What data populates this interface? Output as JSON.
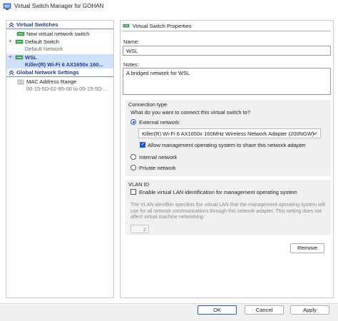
{
  "window": {
    "title": "Virtual Switch Manager for GOHAN"
  },
  "sidebar": {
    "virtual_switches_header": "Virtual Switches",
    "new_switch_label": "New virtual network switch",
    "switches": [
      {
        "name": "Default Switch",
        "detail": "Default Network"
      },
      {
        "name": "WSL",
        "detail": "Killer(R) Wi-Fi 6 AX1650x 160..."
      }
    ],
    "global_header": "Global Network Settings",
    "mac_label": "MAC Address Range",
    "mac_value": "00-15-5D-02-95-00 to 00-15-5D-..."
  },
  "properties": {
    "header": "Virtual Switch Properties",
    "name_label": "Name:",
    "name_value": "WSL",
    "notes_label": "Notes:",
    "notes_value": "A bridged network for WSL",
    "connection_type_label": "Connection type",
    "question": "What do you want to connect this virtual switch to?",
    "external_label": "External network:",
    "adapter_value": "Killer(R) Wi-Fi 6 AX1650x 160MHz Wireless Network Adapter (200NGW)",
    "allow_mgmt_label": "Allow management operating system to share this network adapter",
    "internal_label": "Internal network",
    "private_label": "Private network",
    "vlan_header": "VLAN ID",
    "vlan_enable_label": "Enable virtual LAN identification for management operating system",
    "vlan_description": "The VLAN identifier specifies the virtual LAN that the management operating system will use for all network communications through this network adapter. This setting does not affect virtual machine networking.",
    "vlan_value": "2",
    "remove_label": "Remove"
  },
  "footer": {
    "ok_label": "OK",
    "cancel_label": "Cancel",
    "apply_label": "Apply"
  },
  "state": {
    "connection_type": "external",
    "allow_management_os": true,
    "vlan_enabled": false
  },
  "colors": {
    "accent": "#1f5bd6",
    "section_header": "#1d3f9e",
    "selection": "#cfe0fb"
  }
}
